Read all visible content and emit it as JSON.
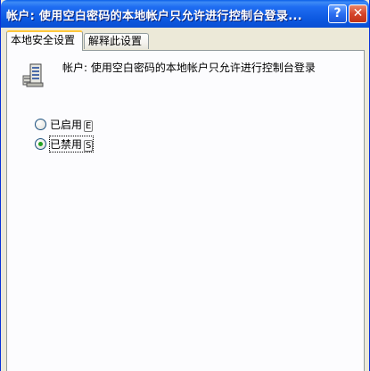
{
  "window": {
    "title": "帐户: 使用空白密码的本地帐户只允许进行控制台登录...",
    "help_label": "?",
    "close_label": "✕"
  },
  "tabs": [
    {
      "label": "本地安全设置",
      "active": true
    },
    {
      "label": "解释此设置",
      "active": false
    }
  ],
  "policy": {
    "icon": "policy-server-icon",
    "text": "帐户: 使用空白密码的本地帐户只允许进行控制台登录"
  },
  "options": [
    {
      "label": "已启用",
      "hotkey": "E",
      "checked": false
    },
    {
      "label": "已禁用",
      "hotkey": "S",
      "checked": true
    }
  ],
  "colors": {
    "titlebar": "#0a5ee8",
    "selected_radio": "#21a121",
    "tab_highlight": "#ffc83c"
  }
}
